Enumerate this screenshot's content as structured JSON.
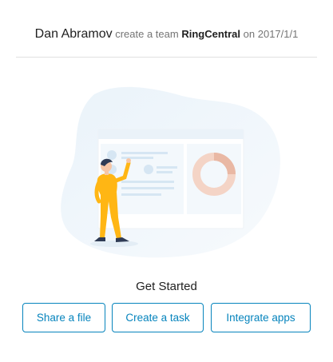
{
  "header": {
    "user_name": "Dan Abramov",
    "action": "create a team",
    "team_name": "RingCentral",
    "date_prefix": "on",
    "date": "2017/1/1"
  },
  "main": {
    "illustration_icon": "person-presenting-dashboard-illustration",
    "get_started_label": "Get Started",
    "actions": {
      "share_label": "Share a file",
      "task_label": "Create a task",
      "apps_label": "Integrate apps"
    }
  },
  "colors": {
    "accent": "#0684bd",
    "figure_shirt": "#ffb614",
    "donut": "#f4d4c6"
  }
}
